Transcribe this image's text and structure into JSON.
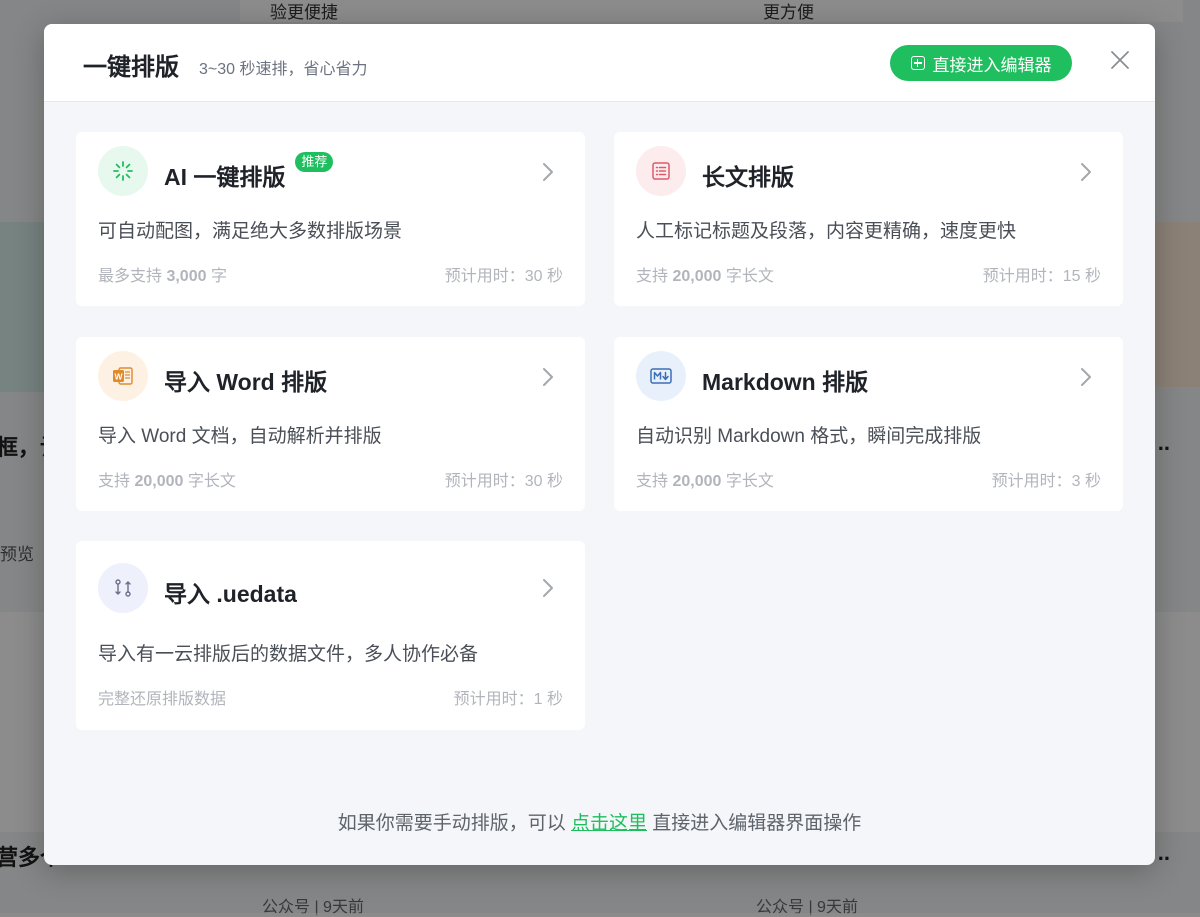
{
  "background": {
    "top_left_text": "验更便捷",
    "top_right_text": "更方便",
    "left_snippet": "框，让",
    "left_small": "预览",
    "left_bottom": "营多个",
    "bottom_left": "公众号  |  9天前",
    "bottom_right": "公众号  |  9天前"
  },
  "modal": {
    "title": "一键排版",
    "subtitle": "3~30 秒速排，省心省力",
    "enter_editor_label": "直接进入编辑器",
    "close_icon": "close-icon"
  },
  "cards": [
    {
      "icon": "spinner-icon",
      "icon_bg": "#e7f8ee",
      "title": "AI 一键排版",
      "badge": "推荐",
      "desc": "可自动配图，满足绝大多数排版场景",
      "limit_prefix": "最多支持 ",
      "limit_value": "3,000",
      "limit_suffix": " 字",
      "time": "预计用时：30 秒"
    },
    {
      "icon": "list-icon",
      "icon_bg": "#fdecee",
      "title": "长文排版",
      "desc": "人工标记标题及段落，内容更精确，速度更快",
      "limit_prefix": "支持 ",
      "limit_value": "20,000",
      "limit_suffix": " 字长文",
      "time": "预计用时：15 秒"
    },
    {
      "icon": "word-icon",
      "icon_bg": "#fdf1e3",
      "title": "导入 Word 排版",
      "desc": "导入 Word 文档，自动解析并排版",
      "limit_prefix": "支持 ",
      "limit_value": "20,000",
      "limit_suffix": " 字长文",
      "time": "预计用时：30 秒"
    },
    {
      "icon": "markdown-icon",
      "icon_bg": "#e8f1fb",
      "title": "Markdown 排版",
      "desc": "自动识别 Markdown 格式，瞬间完成排版",
      "limit_prefix": "支持 ",
      "limit_value": "20,000",
      "limit_suffix": " 字长文",
      "time": "预计用时：3 秒"
    },
    {
      "icon": "git-compare-icon",
      "icon_bg": "#eef0fb",
      "title": "导入 .uedata",
      "desc": "导入有一云排版后的数据文件，多人协作必备",
      "limit_text": "完整还原排版数据",
      "time": "预计用时：1 秒"
    }
  ],
  "footer": {
    "before": "如果你需要手动排版，可以 ",
    "link": "点击这里",
    "after": " 直接进入编辑器界面操作"
  },
  "colors": {
    "accent": "#1fbe5e",
    "modal_bg": "#f4f6f9",
    "title_text": "#1f2329"
  }
}
